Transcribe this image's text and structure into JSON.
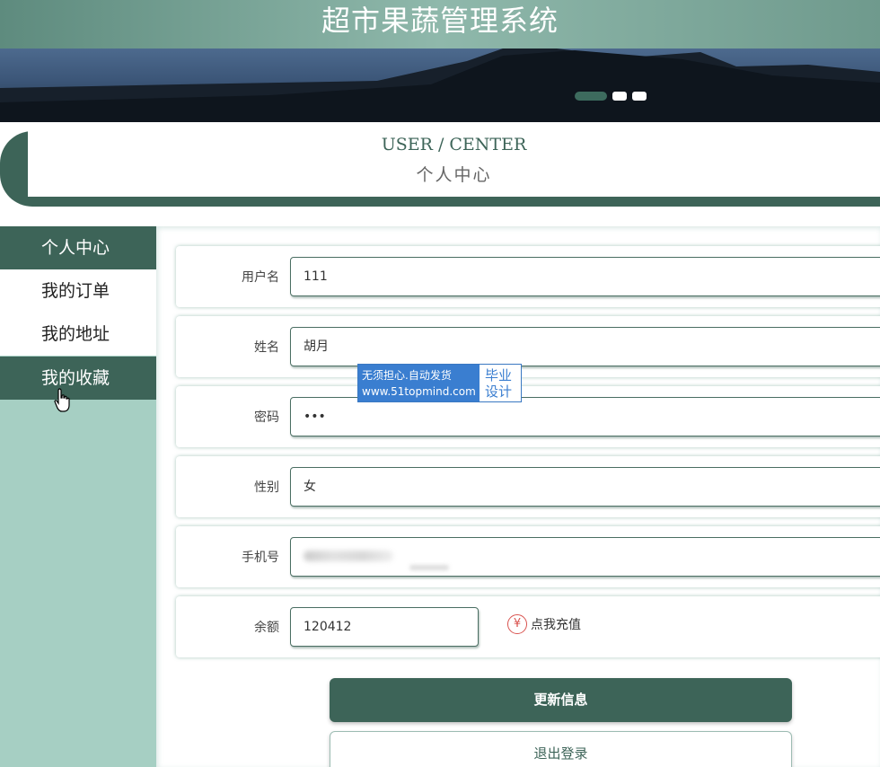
{
  "header": {
    "title": "超市果蔬管理系统"
  },
  "banner": {
    "slides": 3,
    "active_slide": 1
  },
  "user_center": {
    "title_en": "USER / CENTER",
    "title_cn": "个人中心"
  },
  "sidebar": {
    "items": [
      {
        "label": "个人中心",
        "active": true
      },
      {
        "label": "我的订单",
        "active": false
      },
      {
        "label": "我的地址",
        "active": false
      },
      {
        "label": "我的收藏",
        "active": true
      }
    ]
  },
  "form": {
    "username": {
      "label": "用户名",
      "value": "111"
    },
    "name": {
      "label": "姓名",
      "value": "胡月"
    },
    "password": {
      "label": "密码",
      "value": "•••"
    },
    "gender": {
      "label": "性别",
      "value": "女"
    },
    "phone": {
      "label": "手机号",
      "value": ""
    },
    "balance": {
      "label": "余额",
      "value": "120412",
      "recharge_icon": "¥",
      "recharge_label": "点我充值"
    }
  },
  "buttons": {
    "update": "更新信息",
    "logout": "退出登录"
  },
  "watermark": {
    "line1": "无须担心.自动发货",
    "line2": "www.51topmind.com",
    "right1": "毕业",
    "right2": "设计"
  },
  "colors": {
    "primary": "#3d6458",
    "sidebar_bg": "#a6cfc3",
    "danger": "#d9534f"
  }
}
